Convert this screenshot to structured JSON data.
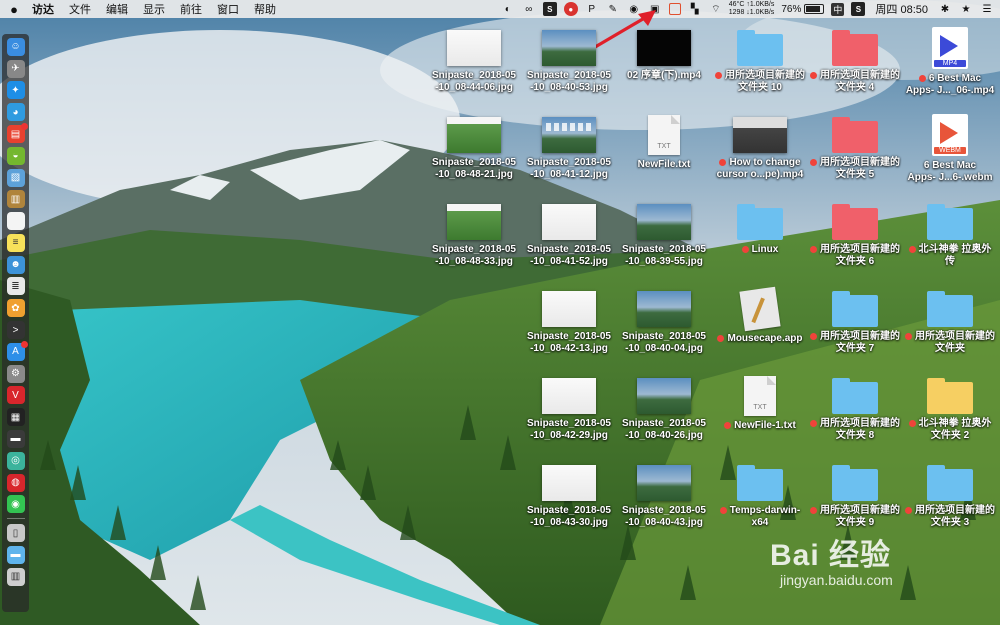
{
  "menubar": {
    "apple": "",
    "app_name": "访达",
    "menus": [
      "文件",
      "编辑",
      "显示",
      "前往",
      "窗口",
      "帮助"
    ],
    "status_icons": [
      "toggle-icon",
      "glasses-icon",
      "s-icon",
      "app-red-icon",
      "p-icon",
      "brush-icon",
      "wechat-icon",
      "snipaste-icon",
      "grid-icon",
      "bookmark-icon",
      "wifi-icon"
    ],
    "cpu_temp": "46°C",
    "fan": "1298",
    "net_up": "↑1.0KB/s",
    "net_down": "↓1.0KB/s",
    "battery": "76%",
    "input_method": "中",
    "spotlight_s": "S",
    "datetime": "周四 08:50"
  },
  "dock": {
    "items": [
      {
        "icon": "finder-icon",
        "color": "#3a8de0"
      },
      {
        "icon": "launchpad-icon",
        "color": "#888"
      },
      {
        "icon": "safari-icon",
        "color": "#1e8ee6"
      },
      {
        "icon": "qq-browser-icon",
        "color": "#2f9be0"
      },
      {
        "icon": "calendar-icon",
        "color": "#e8412f",
        "badge": true
      },
      {
        "icon": "android-icon",
        "color": "#74b72f"
      },
      {
        "icon": "preview-icon",
        "color": "#5da1d9"
      },
      {
        "icon": "notebook-icon",
        "color": "#b0843c"
      },
      {
        "icon": "calendar-10-icon",
        "color": "#f4f4f4"
      },
      {
        "icon": "notes-icon",
        "color": "#f7e15a"
      },
      {
        "icon": "contacts-icon",
        "color": "#3d93d8"
      },
      {
        "icon": "document-icon",
        "color": "#e8e8e8"
      },
      {
        "icon": "photos-icon",
        "color": "#f0a030"
      },
      {
        "icon": "terminal-icon",
        "color": "#333"
      },
      {
        "icon": "appstore-icon",
        "color": "#2e8fe8",
        "badge": true
      },
      {
        "icon": "settings-icon",
        "color": "#8a8a8a"
      },
      {
        "icon": "vivaldi-icon",
        "color": "#d8262c"
      },
      {
        "icon": "activity-icon",
        "color": "#222"
      },
      {
        "icon": "console-icon",
        "color": "#3a3a3a"
      },
      {
        "icon": "sync-icon",
        "color": "#3bb39c"
      },
      {
        "icon": "netease-music-icon",
        "color": "#d8262c"
      },
      {
        "icon": "wechat-dock-icon",
        "color": "#33c452"
      },
      {
        "icon": "iphone-icon",
        "color": "#c8c8c8"
      },
      {
        "icon": "folder-dock-icon",
        "color": "#5fb4ec"
      },
      {
        "icon": "trash-icon",
        "color": "#cfcfcf"
      }
    ]
  },
  "desktop": {
    "items": [
      {
        "name": "Snipaste_2018-05\n-10_08-44-06.jpg",
        "kind": "thumb-white",
        "tag": false
      },
      {
        "name": "Snipaste_2018-05\n-10_08-40-53.jpg",
        "kind": "thumb-desk",
        "tag": false
      },
      {
        "name": "02 序章(下).mp4",
        "kind": "thumb-black",
        "tag": false
      },
      {
        "name": "用所选项目新建的\n文件夹 10",
        "kind": "folder-blue",
        "tag": true
      },
      {
        "name": "用所选项目新建的\n文件夹 4",
        "kind": "folder-red",
        "tag": true
      },
      {
        "name": "6 Best Mac\nApps- J..._06-.mp4",
        "kind": "media-mp4",
        "tag": true
      },
      {
        "name": "Snipaste_2018-05\n-10_08-48-21.jpg",
        "kind": "thumb-green",
        "tag": false
      },
      {
        "name": "Snipaste_2018-05\n-10_08-41-12.jpg",
        "kind": "thumb-desk2",
        "tag": false
      },
      {
        "name": "NewFile.txt",
        "kind": "doc-txt",
        "tag": false
      },
      {
        "name": "How to change\ncursor o...pe).mp4",
        "kind": "thumb-video",
        "tag": true
      },
      {
        "name": "用所选项目新建的\n文件夹 5",
        "kind": "folder-red",
        "tag": true
      },
      {
        "name": "6 Best Mac\nApps- J...6-.webm",
        "kind": "media-webm",
        "tag": false
      },
      {
        "name": "Snipaste_2018-05\n-10_08-48-33.jpg",
        "kind": "thumb-green",
        "tag": false
      },
      {
        "name": "Snipaste_2018-05\n-10_08-41-52.jpg",
        "kind": "thumb-white",
        "tag": false
      },
      {
        "name": "Snipaste_2018-05\n-10_08-39-55.jpg",
        "kind": "thumb-desk",
        "tag": false
      },
      {
        "name": "Linux",
        "kind": "folder-blue",
        "tag": true
      },
      {
        "name": "用所选项目新建的\n文件夹 6",
        "kind": "folder-red",
        "tag": true
      },
      {
        "name": "北斗神拳 拉奥外\n传",
        "kind": "folder-blue",
        "tag": true
      },
      {
        "name": "",
        "kind": "none",
        "tag": false
      },
      {
        "name": "Snipaste_2018-05\n-10_08-42-13.jpg",
        "kind": "thumb-white",
        "tag": false
      },
      {
        "name": "Snipaste_2018-05\n-10_08-40-04.jpg",
        "kind": "thumb-desk",
        "tag": false
      },
      {
        "name": "Mousecape.app",
        "kind": "app-mousecape",
        "tag": true
      },
      {
        "name": "用所选项目新建的\n文件夹 7",
        "kind": "folder-blue",
        "tag": true
      },
      {
        "name": "用所选项目新建的\n文件夹",
        "kind": "folder-blue",
        "tag": true
      },
      {
        "name": "",
        "kind": "none",
        "tag": false
      },
      {
        "name": "Snipaste_2018-05\n-10_08-42-29.jpg",
        "kind": "thumb-white",
        "tag": false
      },
      {
        "name": "Snipaste_2018-05\n-10_08-40-26.jpg",
        "kind": "thumb-desk",
        "tag": false
      },
      {
        "name": "NewFile-1.txt",
        "kind": "doc-txt",
        "tag": true
      },
      {
        "name": "用所选项目新建的\n文件夹 8",
        "kind": "folder-blue",
        "tag": true
      },
      {
        "name": "北斗神拳 拉奥外\n文件夹 2",
        "kind": "folder-yellow",
        "tag": true
      },
      {
        "name": "",
        "kind": "none",
        "tag": false
      },
      {
        "name": "Snipaste_2018-05\n-10_08-43-30.jpg",
        "kind": "thumb-white",
        "tag": false
      },
      {
        "name": "Snipaste_2018-05\n-10_08-40-43.jpg",
        "kind": "thumb-desk",
        "tag": false
      },
      {
        "name": "Temps-darwin-\nx64",
        "kind": "folder-blue",
        "tag": true
      },
      {
        "name": "用所选项目新建的\n文件夹 9",
        "kind": "folder-blue",
        "tag": true
      },
      {
        "name": "用所选项目新建的\n文件夹 3",
        "kind": "folder-blue",
        "tag": true
      }
    ]
  },
  "watermark": {
    "logo": "Bai 经验",
    "url": "jingyan.baidu.com"
  },
  "colors": {
    "folder_blue": "#6cc0f0",
    "folder_red": "#f0606a",
    "folder_yellow": "#f6cf62",
    "tag_red": "#f0433a",
    "arrow_red": "#e0202a"
  }
}
